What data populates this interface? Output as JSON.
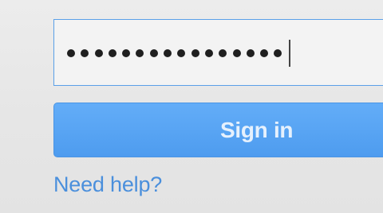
{
  "login_form": {
    "password_field": {
      "value_masked": "••••••••••••••••",
      "masked_character_count": 16
    },
    "signin_button": {
      "label": "Sign in"
    },
    "help_link": {
      "label": "Need help?"
    }
  },
  "colors": {
    "accent_blue": "#4e9cef",
    "link_blue": "#4a8fdc",
    "field_border": "#5aa0e8",
    "background": "#e9e9e9"
  }
}
